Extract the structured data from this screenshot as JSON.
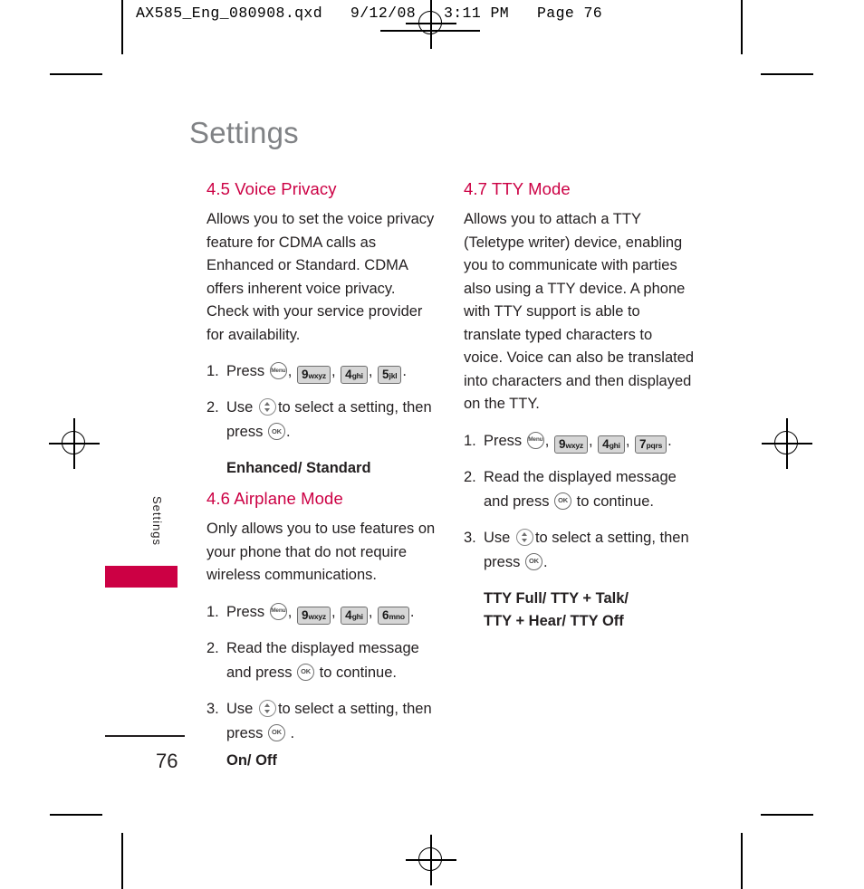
{
  "print": {
    "slug": "AX585_Eng_080908.qxd   9/12/08   3:11 PM   Page 76"
  },
  "page": {
    "title": "Settings",
    "side_tab_label": "Settings",
    "folio": "76",
    "accent_color": "#cc0044",
    "title_color": "#808285"
  },
  "columns": {
    "left": {
      "sections": [
        {
          "heading": "4.5 Voice Privacy",
          "body": "Allows you to set the voice privacy feature for CDMA calls as Enhanced or Standard. CDMA offers inherent voice privacy. Check with your service provider for availability.",
          "steps": [
            {
              "num": "1.",
              "text_before": "Press",
              "keys": [
                {
                  "type": "round",
                  "label": "Menu",
                  "name": "menu-key-icon"
                },
                {
                  "type": "pad",
                  "digit": "9",
                  "letters": "wxyz",
                  "name": "key-9-icon"
                },
                {
                  "type": "pad",
                  "digit": "4",
                  "letters": "ghi",
                  "name": "key-4-icon"
                },
                {
                  "type": "pad",
                  "digit": "5",
                  "letters": "jkl",
                  "name": "key-5-icon"
                }
              ]
            },
            {
              "num": "2.",
              "text_before": "Use",
              "nav_icon": "navigation-key-icon",
              "text_middle": "to select a setting, then press",
              "ok_icon": "ok-key-icon",
              "text_after": "."
            }
          ],
          "options": "Enhanced/ Standard"
        },
        {
          "heading": "4.6 Airplane Mode",
          "body": "Only allows you to use features on your phone that do not require wireless communications.",
          "steps": [
            {
              "num": "1.",
              "text_before": "Press",
              "keys": [
                {
                  "type": "round",
                  "label": "Menu",
                  "name": "menu-key-icon"
                },
                {
                  "type": "pad",
                  "digit": "9",
                  "letters": "wxyz",
                  "name": "key-9-icon"
                },
                {
                  "type": "pad",
                  "digit": "4",
                  "letters": "ghi",
                  "name": "key-4-icon"
                },
                {
                  "type": "pad",
                  "digit": "6",
                  "letters": "mno",
                  "name": "key-6-icon"
                }
              ]
            },
            {
              "num": "2.",
              "text_before": "Read the displayed message and press",
              "ok_icon": "ok-key-icon",
              "text_after": "to continue."
            },
            {
              "num": "3.",
              "text_before": "Use",
              "nav_icon": "navigation-key-icon",
              "text_middle": "to select a setting, then press",
              "ok_icon": "ok-key-icon",
              "text_after": "."
            }
          ],
          "options": "On/ Off"
        }
      ]
    },
    "right": {
      "sections": [
        {
          "heading": "4.7 TTY Mode",
          "body": "Allows you to attach a TTY (Teletype writer) device, enabling you to communicate with parties also using a TTY device. A phone with TTY support is able to translate typed characters to voice. Voice can also be translated into characters and then displayed on the TTY.",
          "steps": [
            {
              "num": "1.",
              "text_before": "Press",
              "keys": [
                {
                  "type": "round",
                  "label": "Menu",
                  "name": "menu-key-icon"
                },
                {
                  "type": "pad",
                  "digit": "9",
                  "letters": "wxyz",
                  "name": "key-9-icon"
                },
                {
                  "type": "pad",
                  "digit": "4",
                  "letters": "ghi",
                  "name": "key-4-icon"
                },
                {
                  "type": "pad",
                  "digit": "7",
                  "letters": "pqrs",
                  "name": "key-7-icon"
                }
              ]
            },
            {
              "num": "2.",
              "text_before": "Read the displayed message and press",
              "ok_icon": "ok-key-icon",
              "text_after": "to continue."
            },
            {
              "num": "3.",
              "text_before": "Use",
              "nav_icon": "navigation-key-icon",
              "text_middle": "to select a setting, then press",
              "ok_icon": "ok-key-icon",
              "text_after": "."
            }
          ],
          "options_line1": "TTY Full/ TTY + Talk/",
          "options_line2": "TTY + Hear/ TTY Off"
        }
      ]
    }
  },
  "keys": {
    "ok_label": "OK",
    "menu_label": "Menu"
  }
}
